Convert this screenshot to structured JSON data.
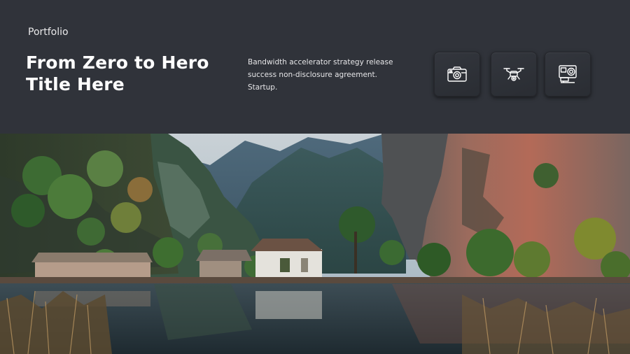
{
  "header": {
    "kicker": "Portfolio",
    "title_line1": "From Zero to Hero",
    "title_line2": "Title Here",
    "description": "Bandwidth accelerator strategy release success non-disclosure agreement. Startup."
  },
  "icons": [
    {
      "name": "camera-icon"
    },
    {
      "name": "drone-icon"
    },
    {
      "name": "action-camera-icon"
    }
  ],
  "colors": {
    "header_bg": "#30333a",
    "text": "#ffffff"
  }
}
